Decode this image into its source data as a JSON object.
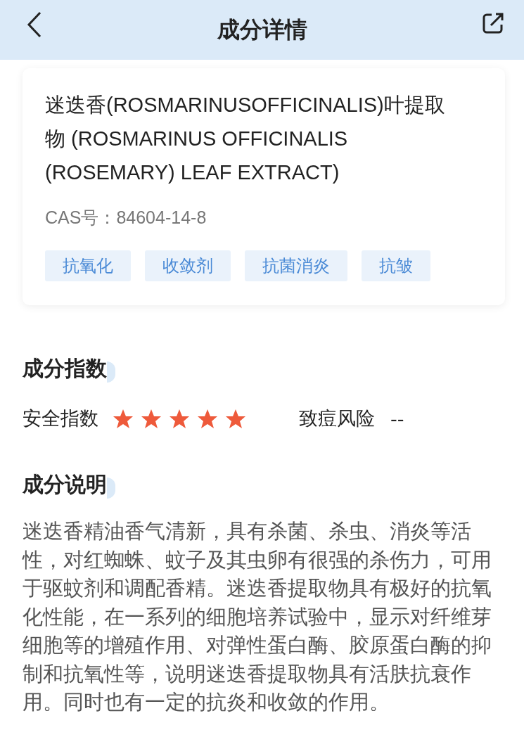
{
  "header": {
    "title": "成分详情"
  },
  "ingredient": {
    "name": "迷迭香(ROSMARINUSOFFICINALIS)叶提取物 (ROSMARINUS OFFICINALIS (ROSEMARY) LEAF EXTRACT)",
    "cas": "CAS号：84604-14-8",
    "tags": [
      "抗氧化",
      "收敛剂",
      "抗菌消炎",
      "抗皱"
    ]
  },
  "index_section": {
    "title": "成分指数",
    "safety_label": "安全指数",
    "stars": 5,
    "acne_label": "致痘风险",
    "acne_value": "--"
  },
  "description_section": {
    "title": "成分说明",
    "text": "迷迭香精油香气清新，具有杀菌、杀虫、消炎等活性，对红蜘蛛、蚊子及其虫卵有很强的杀伤力，可用于驱蚊剂和调配香精。迷迭香提取物具有极好的抗氧化性能，在一系列的细胞培养试验中，显示对纤维芽细胞等的增殖作用、对弹性蛋白酶、胶原蛋白酶的抑制和抗氧性等，说明迷迭香提取物具有活肤抗衰作用。同时也有一定的抗炎和收敛的作用。"
  }
}
